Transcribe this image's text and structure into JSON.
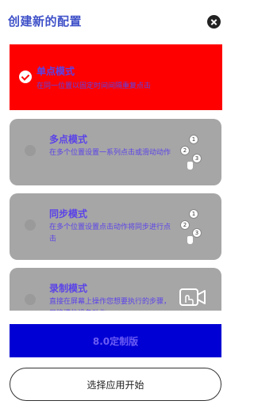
{
  "header": {
    "title": "创建新的配置",
    "close_icon": "close-icon"
  },
  "modes": [
    {
      "title": "单点模式",
      "desc": "在同一位置以固定时间间隔重复点击",
      "selected": true
    },
    {
      "title": "多点模式",
      "desc": "在多个位置设置一系列点击或滑动动作",
      "selected": false,
      "icon": "multi-tap-icon",
      "step_labels": [
        "1",
        "2",
        "3"
      ]
    },
    {
      "title": "同步模式",
      "desc": "在多个位置设置点击动作将同步进行点击",
      "selected": false,
      "icon": "multi-tap-icon",
      "step_labels": [
        "1",
        "2",
        "3"
      ]
    },
    {
      "title": "录制模式",
      "desc": "直接在屏幕上操作您想要执行的步骤，只能模仿设备动作",
      "selected": false,
      "icon": "video-icon"
    }
  ],
  "version_bar": {
    "label": "8.0定制版"
  },
  "start_button": {
    "label": "选择应用开始"
  },
  "colors": {
    "selected_card": "#ff0000",
    "unselected_card": "#a6a6a6",
    "version_bar": "#0000d4",
    "title": "#3f51c8",
    "mode_text": "#5a43e8"
  }
}
